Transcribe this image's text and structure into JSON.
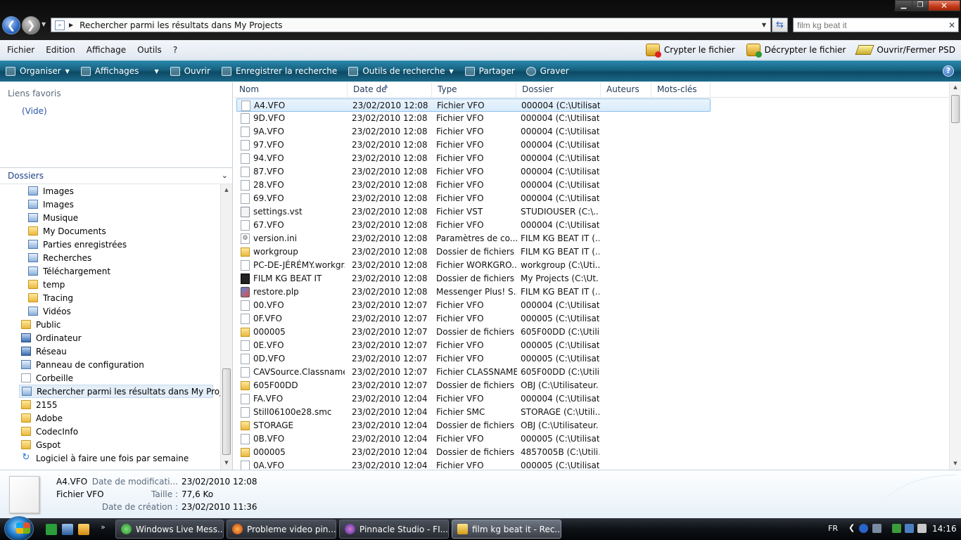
{
  "window": {
    "address": "Rechercher parmi les résultats dans My Projects",
    "search_value": "film kg beat it",
    "minimize_label": "▁",
    "maximize_label": "❐",
    "close_label": "✕"
  },
  "menubar": {
    "items": [
      "Fichier",
      "Edition",
      "Affichage",
      "Outils",
      "?"
    ],
    "actions": [
      "Crypter le fichier",
      "Décrypter le fichier",
      "Ouvrir/Fermer PSD"
    ]
  },
  "cmdbar": {
    "items": [
      "Organiser",
      "Affichages",
      "Ouvrir",
      "Enregistrer la recherche",
      "Outils de recherche",
      "Partager",
      "Graver"
    ]
  },
  "sidebar": {
    "favorites_title": "Liens favoris",
    "favorites_empty": "(Vide)",
    "folders_title": "Dossiers",
    "tree": [
      {
        "label": "Images",
        "icon": "special-folder-icon"
      },
      {
        "label": "Images",
        "icon": "special-folder-icon"
      },
      {
        "label": "Musique",
        "icon": "special-folder-icon"
      },
      {
        "label": "My Documents",
        "icon": "folder-icon"
      },
      {
        "label": "Parties enregistrées",
        "icon": "special-folder-icon"
      },
      {
        "label": "Recherches",
        "icon": "special-folder-icon"
      },
      {
        "label": "Téléchargement",
        "icon": "special-folder-icon"
      },
      {
        "label": "temp",
        "icon": "folder-icon"
      },
      {
        "label": "Tracing",
        "icon": "folder-icon"
      },
      {
        "label": "Vidéos",
        "icon": "special-folder-icon"
      },
      {
        "label": "Public",
        "icon": "folder-icon"
      },
      {
        "label": "Ordinateur",
        "icon": "computer-icon"
      },
      {
        "label": "Réseau",
        "icon": "network-icon"
      },
      {
        "label": "Panneau de configuration",
        "icon": "control-panel-icon"
      },
      {
        "label": "Corbeille",
        "icon": "recycle-bin-icon"
      },
      {
        "label": "Rechercher parmi les résultats dans My Projects",
        "icon": "search-folder-icon"
      },
      {
        "label": "2155",
        "icon": "folder-icon"
      },
      {
        "label": "Adobe",
        "icon": "folder-icon"
      },
      {
        "label": "CodecInfo",
        "icon": "folder-icon"
      },
      {
        "label": "Gspot",
        "icon": "folder-icon"
      },
      {
        "label": "Logiciel à faire une fois par semaine",
        "icon": "refresh-folder-icon"
      }
    ]
  },
  "columns": [
    "Nom",
    "Date de modificati...",
    "Type",
    "Dossier",
    "Auteurs",
    "Mots-clés"
  ],
  "files": [
    {
      "name": "A4.VFO",
      "date": "23/02/2010 12:08",
      "type": "Fichier VFO",
      "folder": "000004 (C:\\Utilisat...",
      "icon": "file"
    },
    {
      "name": "9D.VFO",
      "date": "23/02/2010 12:08",
      "type": "Fichier VFO",
      "folder": "000004 (C:\\Utilisat...",
      "icon": "file"
    },
    {
      "name": "9A.VFO",
      "date": "23/02/2010 12:08",
      "type": "Fichier VFO",
      "folder": "000004 (C:\\Utilisat...",
      "icon": "file"
    },
    {
      "name": "97.VFO",
      "date": "23/02/2010 12:08",
      "type": "Fichier VFO",
      "folder": "000004 (C:\\Utilisat...",
      "icon": "file"
    },
    {
      "name": "94.VFO",
      "date": "23/02/2010 12:08",
      "type": "Fichier VFO",
      "folder": "000004 (C:\\Utilisat...",
      "icon": "file"
    },
    {
      "name": "87.VFO",
      "date": "23/02/2010 12:08",
      "type": "Fichier VFO",
      "folder": "000004 (C:\\Utilisat...",
      "icon": "file"
    },
    {
      "name": "28.VFO",
      "date": "23/02/2010 12:08",
      "type": "Fichier VFO",
      "folder": "000004 (C:\\Utilisat...",
      "icon": "file"
    },
    {
      "name": "69.VFO",
      "date": "23/02/2010 12:08",
      "type": "Fichier VFO",
      "folder": "000004 (C:\\Utilisat...",
      "icon": "file"
    },
    {
      "name": "settings.vst",
      "date": "23/02/2010 12:08",
      "type": "Fichier VST",
      "folder": "STUDIOUSER (C:\\...",
      "icon": "settings"
    },
    {
      "name": "67.VFO",
      "date": "23/02/2010 12:08",
      "type": "Fichier VFO",
      "folder": "000004 (C:\\Utilisat...",
      "icon": "file"
    },
    {
      "name": "version.ini",
      "date": "23/02/2010 12:08",
      "type": "Paramètres de co...",
      "folder": "FILM KG BEAT IT (...",
      "icon": "gear"
    },
    {
      "name": "workgroup",
      "date": "23/02/2010 12:08",
      "type": "Dossier de fichiers",
      "folder": "FILM KG BEAT IT (...",
      "icon": "folder"
    },
    {
      "name": "PC-DE-JÉRÉMY.workgr...",
      "date": "23/02/2010 12:08",
      "type": "Fichier WORKGRO...",
      "folder": "workgroup (C:\\Uti...",
      "icon": "file"
    },
    {
      "name": "FILM KG BEAT IT",
      "date": "23/02/2010 12:08",
      "type": "Dossier de fichiers",
      "folder": "My Projects (C:\\Ut...",
      "icon": "film"
    },
    {
      "name": "restore.plp",
      "date": "23/02/2010 12:08",
      "type": "Messenger Plus! S...",
      "folder": "FILM KG BEAT IT (...",
      "icon": "plp"
    },
    {
      "name": "00.VFO",
      "date": "23/02/2010 12:07",
      "type": "Fichier VFO",
      "folder": "000004 (C:\\Utilisat...",
      "icon": "file"
    },
    {
      "name": "0F.VFO",
      "date": "23/02/2010 12:07",
      "type": "Fichier VFO",
      "folder": "000005 (C:\\Utilisat...",
      "icon": "file"
    },
    {
      "name": "000005",
      "date": "23/02/2010 12:07",
      "type": "Dossier de fichiers",
      "folder": "605F00DD (C:\\Utili...",
      "icon": "folder"
    },
    {
      "name": "0E.VFO",
      "date": "23/02/2010 12:07",
      "type": "Fichier VFO",
      "folder": "000005 (C:\\Utilisat...",
      "icon": "file"
    },
    {
      "name": "0D.VFO",
      "date": "23/02/2010 12:07",
      "type": "Fichier VFO",
      "folder": "000005 (C:\\Utilisat...",
      "icon": "file"
    },
    {
      "name": "CAVSource.Classname",
      "date": "23/02/2010 12:07",
      "type": "Fichier CLASSNAME",
      "folder": "605F00DD (C:\\Utili...",
      "icon": "file"
    },
    {
      "name": "605F00DD",
      "date": "23/02/2010 12:07",
      "type": "Dossier de fichiers",
      "folder": "OBJ (C:\\Utilisateur...",
      "icon": "folder"
    },
    {
      "name": "FA.VFO",
      "date": "23/02/2010 12:04",
      "type": "Fichier VFO",
      "folder": "000004 (C:\\Utilisat...",
      "icon": "file"
    },
    {
      "name": "Still06100e28.smc",
      "date": "23/02/2010 12:04",
      "type": "Fichier SMC",
      "folder": "STORAGE (C:\\Utili...",
      "icon": "file"
    },
    {
      "name": "STORAGE",
      "date": "23/02/2010 12:04",
      "type": "Dossier de fichiers",
      "folder": "OBJ (C:\\Utilisateur...",
      "icon": "folder"
    },
    {
      "name": "0B.VFO",
      "date": "23/02/2010 12:04",
      "type": "Fichier VFO",
      "folder": "000005 (C:\\Utilisat...",
      "icon": "file"
    },
    {
      "name": "000005",
      "date": "23/02/2010 12:04",
      "type": "Dossier de fichiers",
      "folder": "4857005B (C:\\Utili...",
      "icon": "folder"
    },
    {
      "name": "0A.VFO",
      "date": "23/02/2010 12:04",
      "type": "Fichier VFO",
      "folder": "000005 (C:\\Utilisat...",
      "icon": "file"
    }
  ],
  "details": {
    "name": "A4.VFO",
    "type": "Fichier VFO",
    "modified_label": "Date de modificati...",
    "modified_value": "23/02/2010 12:08",
    "size_label": "Taille :",
    "size_value": "77,6 Ko",
    "created_label": "Date de création :",
    "created_value": "23/02/2010 11:36"
  },
  "taskbar": {
    "buttons": [
      "Windows Live Mess...",
      "Probleme video pin...",
      "Pinnacle Studio - FI...",
      "film kg beat it - Rec..."
    ],
    "language": "FR",
    "clock": "14:16"
  }
}
